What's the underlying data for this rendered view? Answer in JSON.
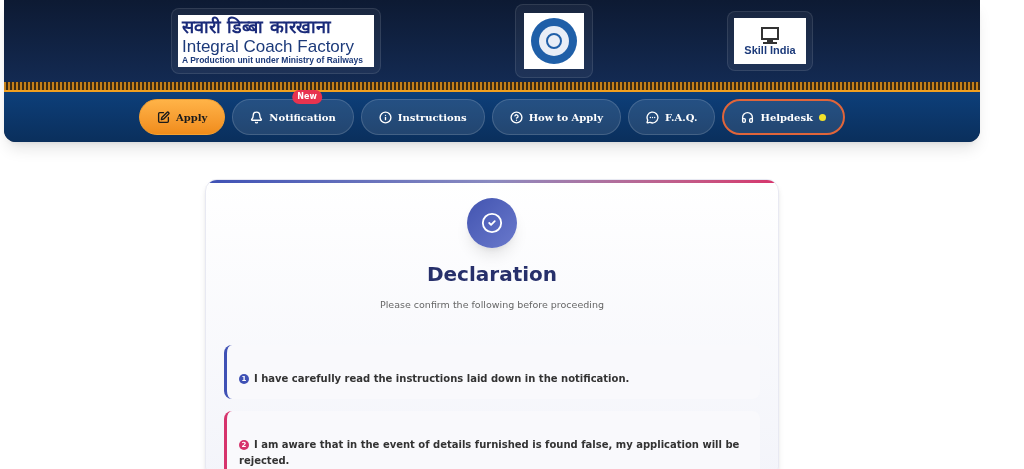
{
  "header": {
    "logos": [
      {
        "kind": "icf",
        "lines": [
          "सवारी डिब्बा कारखाना",
          "Integral Coach Factory",
          "A Production unit under Ministry of Railways"
        ]
      },
      {
        "kind": "emblem"
      },
      {
        "kind": "skill",
        "lines": [
          "Skill India"
        ]
      }
    ]
  },
  "nav": [
    {
      "label": "Apply",
      "kind": "primary"
    },
    {
      "label": "Notification",
      "kind": "plain",
      "badge": "New"
    },
    {
      "label": "Instructions",
      "kind": "plain"
    },
    {
      "label": "How to Apply",
      "kind": "plain"
    },
    {
      "label": "F.A.Q.",
      "kind": "plain"
    },
    {
      "label": "Helpdesk",
      "kind": "outlined",
      "status_dot": true
    }
  ],
  "declaration": {
    "title": "Declaration",
    "subtitle": "Please confirm the following before proceeding",
    "items": [
      {
        "number": "1",
        "color": "#3f51b5",
        "text": "I have carefully read the instructions laid down in the notification."
      },
      {
        "number": "2",
        "color": "#d6336c",
        "text": "I am aware that in the event of details furnished is found false, my application will be rejected."
      }
    ]
  }
}
